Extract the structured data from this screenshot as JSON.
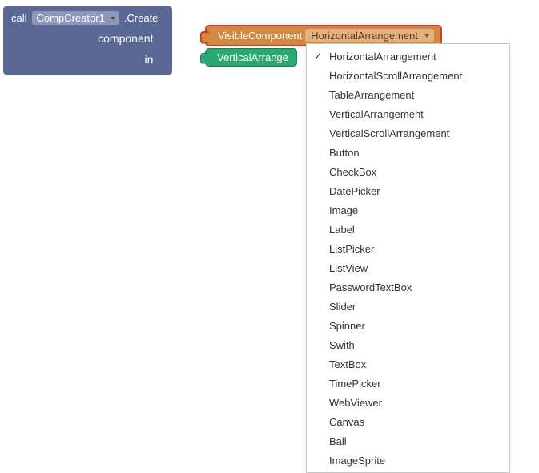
{
  "call_block": {
    "call_keyword": "call",
    "object_dropdown": "CompCreator1",
    "method_suffix": ".Create",
    "args": {
      "component_label": "component",
      "in_label": "in"
    }
  },
  "visible_component_block": {
    "prefix": "VisibleComponent",
    "selected": "HorizontalArrangement"
  },
  "green_block": {
    "label": "VerticalArrange"
  },
  "dropdown_menu": {
    "items": [
      {
        "label": "HorizontalArrangement",
        "checked": true
      },
      {
        "label": "HorizontalScrollArrangement",
        "checked": false
      },
      {
        "label": "TableArrangement",
        "checked": false
      },
      {
        "label": "VerticalArrangement",
        "checked": false
      },
      {
        "label": "VerticalScrollArrangement",
        "checked": false
      },
      {
        "label": "Button",
        "checked": false
      },
      {
        "label": "CheckBox",
        "checked": false
      },
      {
        "label": "DatePicker",
        "checked": false
      },
      {
        "label": "Image",
        "checked": false
      },
      {
        "label": "Label",
        "checked": false
      },
      {
        "label": "ListPicker",
        "checked": false
      },
      {
        "label": "ListView",
        "checked": false
      },
      {
        "label": "PasswordTextBox",
        "checked": false
      },
      {
        "label": "Slider",
        "checked": false
      },
      {
        "label": "Spinner",
        "checked": false
      },
      {
        "label": "Swith",
        "checked": false
      },
      {
        "label": "TextBox",
        "checked": false
      },
      {
        "label": "TimePicker",
        "checked": false
      },
      {
        "label": "WebViewer",
        "checked": false
      },
      {
        "label": "Canvas",
        "checked": false
      },
      {
        "label": "Ball",
        "checked": false
      },
      {
        "label": "ImageSprite",
        "checked": false
      }
    ]
  }
}
